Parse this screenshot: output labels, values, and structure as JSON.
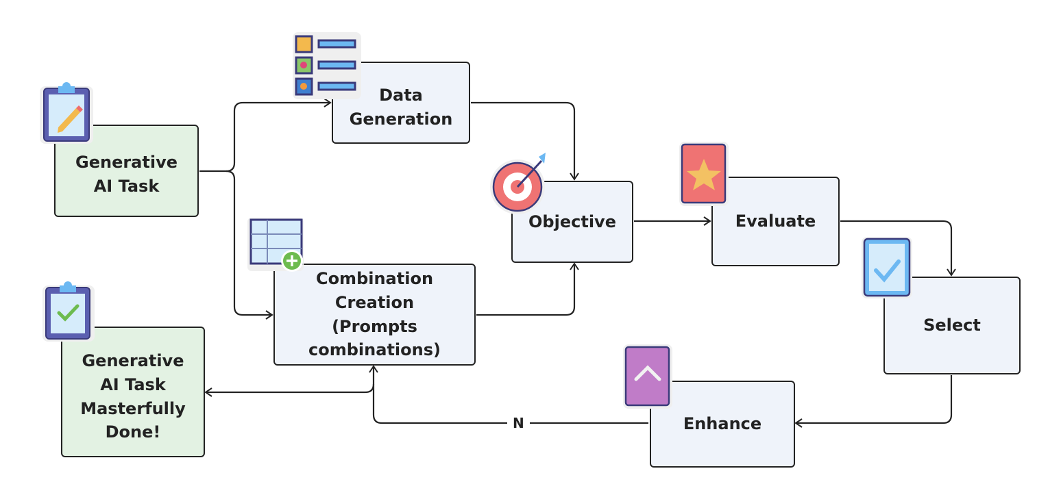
{
  "nodes": {
    "task": "Generative\nAI Task",
    "data_generation": "Data\nGeneration",
    "combination": "Combination Creation\n(Prompts\ncombinations)",
    "objective": "Objective",
    "evaluate": "Evaluate",
    "select": "Select",
    "enhance": "Enhance",
    "done": "Generative\nAI Task\nMasterfully\nDone!"
  },
  "edge_labels": {
    "no": "N"
  },
  "icons": [
    "clipboard-pencil-icon",
    "image-list-icon",
    "table-add-icon",
    "target-icon",
    "star-icon",
    "checkbox-icon",
    "chevron-up-icon",
    "clipboard-check-icon"
  ],
  "colors": {
    "node_fill": "#eff3fa",
    "start_end_fill": "#e3f2e3",
    "stroke": "#222222"
  }
}
